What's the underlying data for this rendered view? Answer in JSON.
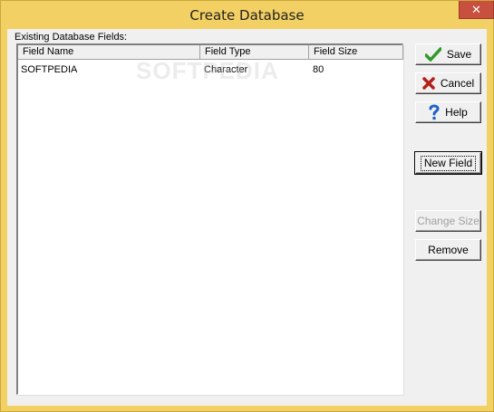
{
  "window": {
    "title": "Create Database",
    "close_symbol": "✕"
  },
  "watermark": "SOFTPEDIA",
  "list": {
    "label": "Existing Database Fields:",
    "columns": [
      "Field Name",
      "Field Type",
      "Field Size"
    ],
    "rows": [
      {
        "name": "SOFTPEDIA",
        "type": "Character",
        "size": "80"
      }
    ]
  },
  "buttons": {
    "save": "Save",
    "cancel": "Cancel",
    "help": "Help",
    "new_field": "New Field",
    "change_size": "Change Size",
    "remove": "Remove"
  },
  "colors": {
    "titlebar": "#f2d063",
    "close_button": "#c7503f",
    "dialog_face": "#f0f0f0",
    "save_check": "#2e9a28",
    "cancel_x": "#b3201a",
    "help_question": "#1f63c6"
  },
  "icons": {
    "save": "check-icon",
    "cancel": "x-icon",
    "help": "question-icon"
  }
}
